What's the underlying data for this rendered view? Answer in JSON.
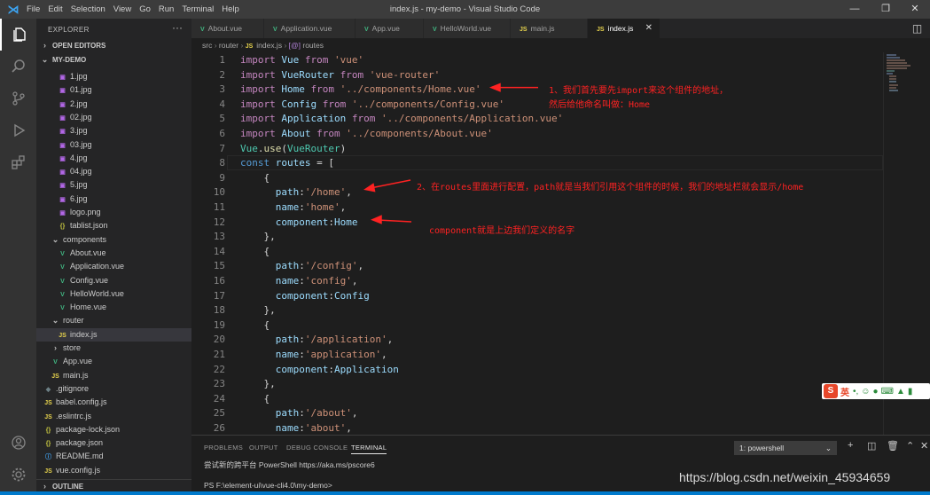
{
  "window": {
    "menu": [
      "File",
      "Edit",
      "Selection",
      "View",
      "Go",
      "Run",
      "Terminal",
      "Help"
    ],
    "title": "index.js - my-demo - Visual Studio Code"
  },
  "explorer": {
    "title": "EXPLORER",
    "open_editors": "OPEN EDITORS",
    "root": "MY-DEMO",
    "outline": "OUTLINE",
    "items": [
      {
        "label": "1.jpg",
        "icon": "image-icon",
        "kind": "img",
        "indent": 2
      },
      {
        "label": "01.jpg",
        "icon": "image-icon",
        "kind": "img",
        "indent": 2
      },
      {
        "label": "2.jpg",
        "icon": "image-icon",
        "kind": "img",
        "indent": 2
      },
      {
        "label": "02.jpg",
        "icon": "image-icon",
        "kind": "img",
        "indent": 2
      },
      {
        "label": "3.jpg",
        "icon": "image-icon",
        "kind": "img",
        "indent": 2
      },
      {
        "label": "03.jpg",
        "icon": "image-icon",
        "kind": "img",
        "indent": 2
      },
      {
        "label": "4.jpg",
        "icon": "image-icon",
        "kind": "img",
        "indent": 2
      },
      {
        "label": "04.jpg",
        "icon": "image-icon",
        "kind": "img",
        "indent": 2
      },
      {
        "label": "5.jpg",
        "icon": "image-icon",
        "kind": "img",
        "indent": 2
      },
      {
        "label": "6.jpg",
        "icon": "image-icon",
        "kind": "img",
        "indent": 2
      },
      {
        "label": "logo.png",
        "icon": "image-icon",
        "kind": "img",
        "indent": 2
      },
      {
        "label": "tablist.json",
        "icon": "json-icon",
        "kind": "json",
        "indent": 2
      },
      {
        "label": "components",
        "icon": "chevron-down-icon",
        "kind": "chev",
        "indent": 1
      },
      {
        "label": "About.vue",
        "icon": "vue-icon",
        "kind": "vue",
        "indent": 2
      },
      {
        "label": "Application.vue",
        "icon": "vue-icon",
        "kind": "vue",
        "indent": 2
      },
      {
        "label": "Config.vue",
        "icon": "vue-icon",
        "kind": "vue",
        "indent": 2
      },
      {
        "label": "HelloWorld.vue",
        "icon": "vue-icon",
        "kind": "vue",
        "indent": 2
      },
      {
        "label": "Home.vue",
        "icon": "vue-icon",
        "kind": "vue",
        "indent": 2
      },
      {
        "label": "router",
        "icon": "chevron-down-icon",
        "kind": "chev",
        "indent": 1
      },
      {
        "label": "index.js",
        "icon": "js-icon",
        "kind": "js",
        "indent": 2,
        "selected": true
      },
      {
        "label": "store",
        "icon": "chevron-right-icon",
        "kind": "chev",
        "indent": 1
      },
      {
        "label": "App.vue",
        "icon": "vue-icon",
        "kind": "vue",
        "indent": 1
      },
      {
        "label": "main.js",
        "icon": "js-icon",
        "kind": "js",
        "indent": 1
      },
      {
        "label": ".gitignore",
        "icon": "git-icon",
        "kind": "git",
        "indent": 0
      },
      {
        "label": "babel.config.js",
        "icon": "js-icon",
        "kind": "js",
        "indent": 0
      },
      {
        "label": ".eslintrc.js",
        "icon": "js-icon",
        "kind": "js",
        "indent": 0
      },
      {
        "label": "package-lock.json",
        "icon": "json-icon",
        "kind": "json",
        "indent": 0
      },
      {
        "label": "package.json",
        "icon": "json-icon",
        "kind": "json",
        "indent": 0
      },
      {
        "label": "README.md",
        "icon": "info-icon",
        "kind": "info",
        "indent": 0
      },
      {
        "label": "vue.config.js",
        "icon": "js-icon",
        "kind": "js",
        "indent": 0
      }
    ]
  },
  "tabs": [
    {
      "label": "About.vue",
      "icon": "vue-icon",
      "active": false
    },
    {
      "label": "Application.vue",
      "icon": "vue-icon",
      "active": false
    },
    {
      "label": "App.vue",
      "icon": "vue-icon",
      "active": false
    },
    {
      "label": "HelloWorld.vue",
      "icon": "vue-icon",
      "active": false
    },
    {
      "label": "main.js",
      "icon": "js-icon",
      "active": false
    },
    {
      "label": "index.js",
      "icon": "js-icon",
      "active": true
    }
  ],
  "breadcrumb": [
    "src",
    "router",
    "index.js",
    "routes"
  ],
  "code": [
    [
      [
        "import ",
        "kc"
      ],
      [
        "Vue ",
        "var"
      ],
      [
        "from ",
        "kc"
      ],
      [
        "'vue'",
        "str"
      ]
    ],
    [
      [
        "import ",
        "kc"
      ],
      [
        "VueRouter ",
        "var"
      ],
      [
        "from ",
        "kc"
      ],
      [
        "'vue-router'",
        "str"
      ]
    ],
    [
      [
        "import ",
        "kc"
      ],
      [
        "Home ",
        "var"
      ],
      [
        "from ",
        "kc"
      ],
      [
        "'../components/Home.vue'",
        "str"
      ]
    ],
    [
      [
        "import ",
        "kc"
      ],
      [
        "Config ",
        "var"
      ],
      [
        "from ",
        "kc"
      ],
      [
        "'../components/Config.vue'",
        "str"
      ]
    ],
    [
      [
        "import ",
        "kc"
      ],
      [
        "Application ",
        "var"
      ],
      [
        "from ",
        "kc"
      ],
      [
        "'../components/Application.vue'",
        "str"
      ]
    ],
    [
      [
        "import ",
        "kc"
      ],
      [
        "About ",
        "var"
      ],
      [
        "from ",
        "kc"
      ],
      [
        "'../components/About.vue'",
        "str"
      ]
    ],
    [
      [
        "Vue",
        "cls"
      ],
      [
        ".",
        "pun"
      ],
      [
        "use",
        "fn"
      ],
      [
        "(",
        "pun"
      ],
      [
        "VueRouter",
        "cls"
      ],
      [
        ")",
        "pun"
      ]
    ],
    [
      [
        "const ",
        "kw"
      ],
      [
        "routes ",
        "var"
      ],
      [
        "= [",
        "pun"
      ]
    ],
    [
      [
        "    {",
        "pun"
      ]
    ],
    [
      [
        "      path",
        "var"
      ],
      [
        ":",
        "pun"
      ],
      [
        "'/home'",
        "str"
      ],
      [
        ",",
        "pun"
      ]
    ],
    [
      [
        "      name",
        "var"
      ],
      [
        ":",
        "pun"
      ],
      [
        "'home'",
        "str"
      ],
      [
        ",",
        "pun"
      ]
    ],
    [
      [
        "      component",
        "var"
      ],
      [
        ":",
        "pun"
      ],
      [
        "Home",
        "var"
      ]
    ],
    [
      [
        "    },",
        "pun"
      ]
    ],
    [
      [
        "    {",
        "pun"
      ]
    ],
    [
      [
        "      path",
        "var"
      ],
      [
        ":",
        "pun"
      ],
      [
        "'/config'",
        "str"
      ],
      [
        ",",
        "pun"
      ]
    ],
    [
      [
        "      name",
        "var"
      ],
      [
        ":",
        "pun"
      ],
      [
        "'config'",
        "str"
      ],
      [
        ",",
        "pun"
      ]
    ],
    [
      [
        "      component",
        "var"
      ],
      [
        ":",
        "pun"
      ],
      [
        "Config",
        "var"
      ]
    ],
    [
      [
        "    },",
        "pun"
      ]
    ],
    [
      [
        "    {",
        "pun"
      ]
    ],
    [
      [
        "      path",
        "var"
      ],
      [
        ":",
        "pun"
      ],
      [
        "'/application'",
        "str"
      ],
      [
        ",",
        "pun"
      ]
    ],
    [
      [
        "      name",
        "var"
      ],
      [
        ":",
        "pun"
      ],
      [
        "'application'",
        "str"
      ],
      [
        ",",
        "pun"
      ]
    ],
    [
      [
        "      component",
        "var"
      ],
      [
        ":",
        "pun"
      ],
      [
        "Application",
        "var"
      ]
    ],
    [
      [
        "    },",
        "pun"
      ]
    ],
    [
      [
        "    {",
        "pun"
      ]
    ],
    [
      [
        "      path",
        "var"
      ],
      [
        ":",
        "pun"
      ],
      [
        "'/about'",
        "str"
      ],
      [
        ",",
        "pun"
      ]
    ],
    [
      [
        "      name",
        "var"
      ],
      [
        ":",
        "pun"
      ],
      [
        "'about'",
        "str"
      ],
      [
        ",",
        "pun"
      ]
    ]
  ],
  "annotations": {
    "a1_line1": "1、我们首先要先import来这个组件的地址，",
    "a1_line2": "然后给他命名叫做：Home",
    "a2": "2、在routes里面进行配置，path就是当我们引用这个组件的时候，我们的地址栏就会显示/home",
    "a3": "component就是上边我们定义的名字"
  },
  "panel": {
    "tabs": [
      "PROBLEMS",
      "OUTPUT",
      "DEBUG CONSOLE",
      "TERMINAL"
    ],
    "active_tab": "TERMINAL",
    "shell": "1: powershell",
    "terminal_line1": "尝试新的跨平台 PowerShell https://aka.ms/pscore6",
    "terminal_line2": "PS F:\\element-ui\\vue-cli4.0\\my-demo>"
  },
  "ime": {
    "label": "英"
  },
  "watermark": "https://blog.csdn.net/weixin_45934659",
  "colors": {
    "accent": "#007acc",
    "annotation": "#ff2222",
    "selection": "#37373d"
  }
}
